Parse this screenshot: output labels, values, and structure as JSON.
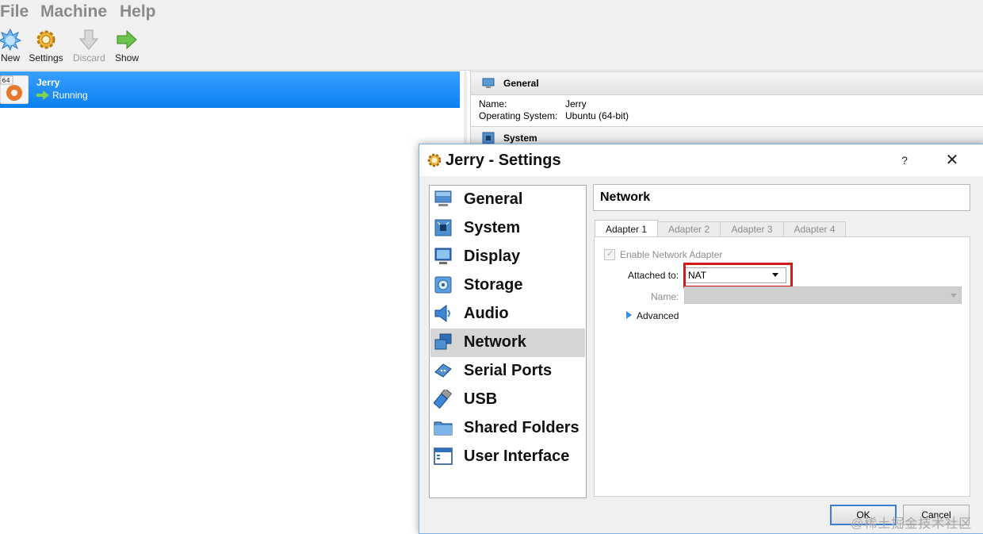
{
  "menubar": {
    "items": [
      "File",
      "Machine",
      "Help"
    ]
  },
  "toolbar": {
    "new": {
      "label": "New",
      "icon": "starburst-new-icon"
    },
    "settings": {
      "label": "Settings",
      "icon": "gear-icon"
    },
    "discard": {
      "label": "Discard",
      "icon": "down-arrow-icon"
    },
    "show": {
      "label": "Show",
      "icon": "right-arrow-icon"
    }
  },
  "vm_list": {
    "items": [
      {
        "name": "Jerry",
        "state": "Running",
        "badge": "64",
        "selected": true
      }
    ]
  },
  "details": {
    "general": {
      "title": "General",
      "name_key": "Name:",
      "name_val": "Jerry",
      "os_key": "Operating System:",
      "os_val": "Ubuntu (64-bit)"
    },
    "system": {
      "title": "System"
    }
  },
  "dialog": {
    "title": "Jerry - Settings",
    "help": "?",
    "close": "✕",
    "nav": [
      {
        "label": "General",
        "icon": "monitor-general-icon"
      },
      {
        "label": "System",
        "icon": "chip-icon"
      },
      {
        "label": "Display",
        "icon": "display-icon"
      },
      {
        "label": "Storage",
        "icon": "disk-icon"
      },
      {
        "label": "Audio",
        "icon": "speaker-icon"
      },
      {
        "label": "Network",
        "icon": "network-icon",
        "selected": true
      },
      {
        "label": "Serial Ports",
        "icon": "serial-port-icon"
      },
      {
        "label": "USB",
        "icon": "usb-icon"
      },
      {
        "label": "Shared Folders",
        "icon": "folder-icon"
      },
      {
        "label": "User Interface",
        "icon": "window-icon"
      }
    ],
    "page_title": "Network",
    "tabs": [
      "Adapter 1",
      "Adapter 2",
      "Adapter 3",
      "Adapter 4"
    ],
    "active_tab": 0,
    "adapter": {
      "enable_label": "Enable Network Adapter",
      "enable_checked": true,
      "attached_label": "Attached to:",
      "attached_value": "NAT",
      "name_label": "Name:",
      "name_value": "",
      "advanced_label": "Advanced"
    },
    "buttons": {
      "ok": "OK",
      "cancel": "Cancel"
    }
  },
  "watermark": "@稀土掘金技术社区",
  "colors": {
    "selection": "#1e8fff",
    "highlight": "#d11a1a",
    "focus": "#3c7fd1"
  }
}
